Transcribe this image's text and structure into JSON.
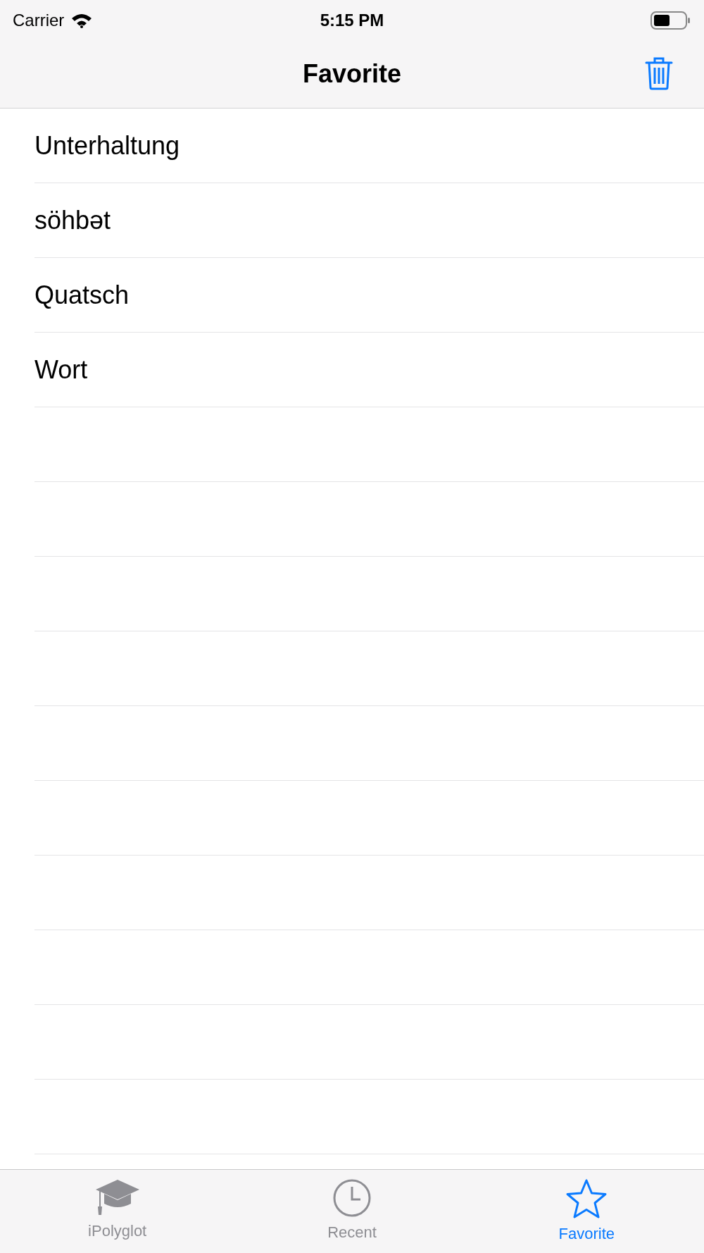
{
  "status_bar": {
    "carrier": "Carrier",
    "time": "5:15 PM"
  },
  "nav_bar": {
    "title": "Favorite"
  },
  "list": {
    "items": [
      "Unterhaltung",
      "söhbət",
      "Quatsch",
      "Wort"
    ]
  },
  "tab_bar": {
    "tabs": [
      {
        "label": "iPolyglot",
        "kind": "cap",
        "selected": false
      },
      {
        "label": "Recent",
        "kind": "clock",
        "selected": false
      },
      {
        "label": "Favorite",
        "kind": "star",
        "selected": true
      }
    ]
  }
}
